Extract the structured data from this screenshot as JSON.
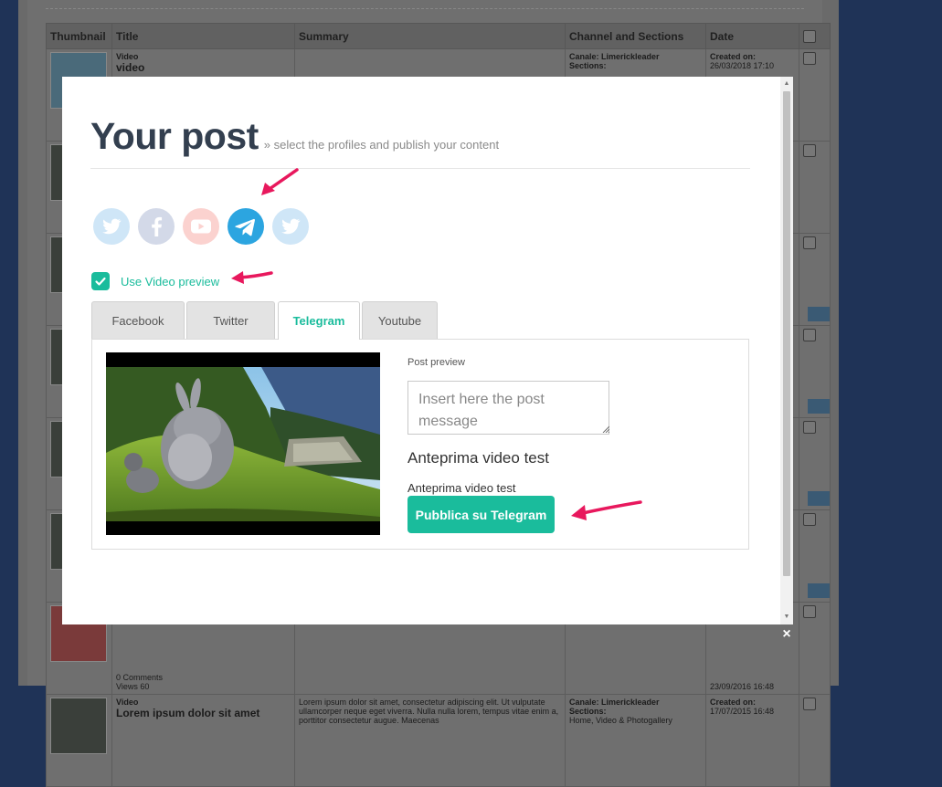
{
  "background": {
    "columns": [
      "Thumbnail",
      "Title",
      "Summary",
      "Channel and Sections",
      "Date"
    ],
    "rows": [
      {
        "title_kind": "Video",
        "title": "video",
        "summary": "",
        "channel": "Canale: Limerickleader",
        "sections_label": "Sections:",
        "date_label": "Created on:",
        "date": "26/03/2018 17:10"
      },
      {
        "title_kind": "",
        "title": "",
        "summary": "",
        "channel": "",
        "sections_label": "",
        "date_label": "",
        "date": ""
      },
      {
        "title_kind": "",
        "title": "",
        "summary": "",
        "channel": "",
        "sections_label": "",
        "date_label": "",
        "date": ""
      },
      {
        "title_kind": "",
        "title": "",
        "summary": "",
        "channel": "",
        "sections_label": "",
        "date_label": "",
        "date": ""
      },
      {
        "title_kind": "",
        "title": "",
        "summary": "",
        "channel": "",
        "sections_label": "",
        "date_label": "",
        "date": ""
      },
      {
        "title_kind": "",
        "title": "",
        "summary": "",
        "channel": "",
        "sections_label": "",
        "date_label": "",
        "date": ""
      },
      {
        "title_kind": "",
        "title": "0 Comments",
        "title_sub": "Views 60",
        "summary": "",
        "channel": "",
        "sections_label": "",
        "date_label": "",
        "date": "23/09/2016 16:48"
      },
      {
        "title_kind": "Video",
        "title": "Lorem ipsum dolor sit amet",
        "summary": "Lorem ipsum dolor sit amet, consectetur adipiscing elit. Ut vulputate ullamcorper neque eget viverra. Nulla nulla lorem, tempus vitae enim a, porttitor consectetur augue. Maecenas",
        "channel": "Canale: Limerickleader",
        "sections_label": "Sections:",
        "sections_value": "Home, Video & Photogallery",
        "date_label": "Created on:",
        "date": "17/07/2015 16:48"
      }
    ]
  },
  "modal": {
    "title": "Your post",
    "subtitle": "» select the profiles and publish your content",
    "profiles": [
      {
        "icon": "twitter-icon",
        "color": "#55acee",
        "selected": false
      },
      {
        "icon": "facebook-icon",
        "color": "#3b5998",
        "selected": false
      },
      {
        "icon": "youtube-icon",
        "color": "#e62117",
        "selected": false
      },
      {
        "icon": "telegram-icon",
        "color": "#2ca5e0",
        "selected": true
      },
      {
        "icon": "twitter-icon",
        "color": "#55acee",
        "selected": false
      }
    ],
    "use_video_preview": {
      "label": "Use Video preview",
      "checked": true
    },
    "tabs": [
      {
        "label": "Facebook",
        "active": false
      },
      {
        "label": "Twitter",
        "active": false
      },
      {
        "label": "Telegram",
        "active": true
      },
      {
        "label": "Youtube",
        "active": false
      }
    ],
    "post_preview": {
      "label": "Post preview",
      "placeholder": "Insert here the post message",
      "video_title": "Anteprima video test",
      "caption": "Anteprima video test",
      "publish_label": "Pubblica su Telegram"
    },
    "close_label": "×"
  },
  "colors": {
    "accent": "#1abc9c",
    "arrow": "#e8185d",
    "overlay": "#1f3357"
  }
}
